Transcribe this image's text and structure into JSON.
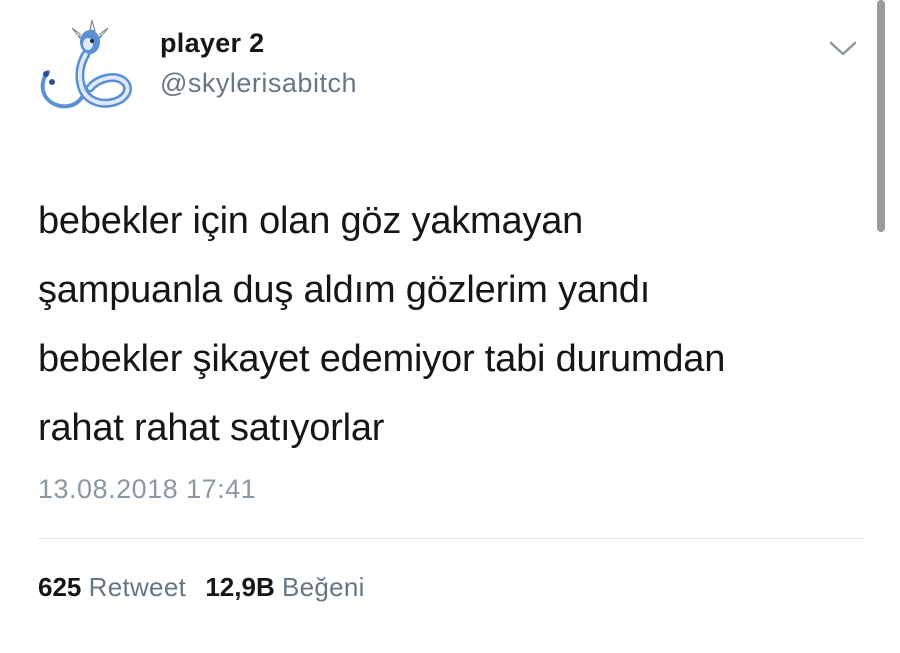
{
  "tweet": {
    "user": {
      "display_name": "player 2",
      "handle": "@skylerisabitch",
      "avatar": "dragonair-avatar"
    },
    "text_lines": [
      "bebekler için olan göz yakmayan",
      "şampuanla duş aldım gözlerim yandı",
      "bebekler şikayet edemiyor tabi durumdan",
      "rahat rahat satıyorlar"
    ],
    "timestamp": "13.08.2018 17:41",
    "stats": {
      "retweets_count": "625",
      "retweets_label": "Retweet",
      "likes_count": "12,9B",
      "likes_label": "Beğeni"
    },
    "menu_icon": "chevron-down-icon"
  },
  "colors": {
    "text_primary": "#14171a",
    "text_secondary": "#657786",
    "divider": "#e1e8ed",
    "avatar_blue": "#5b8fd6"
  }
}
